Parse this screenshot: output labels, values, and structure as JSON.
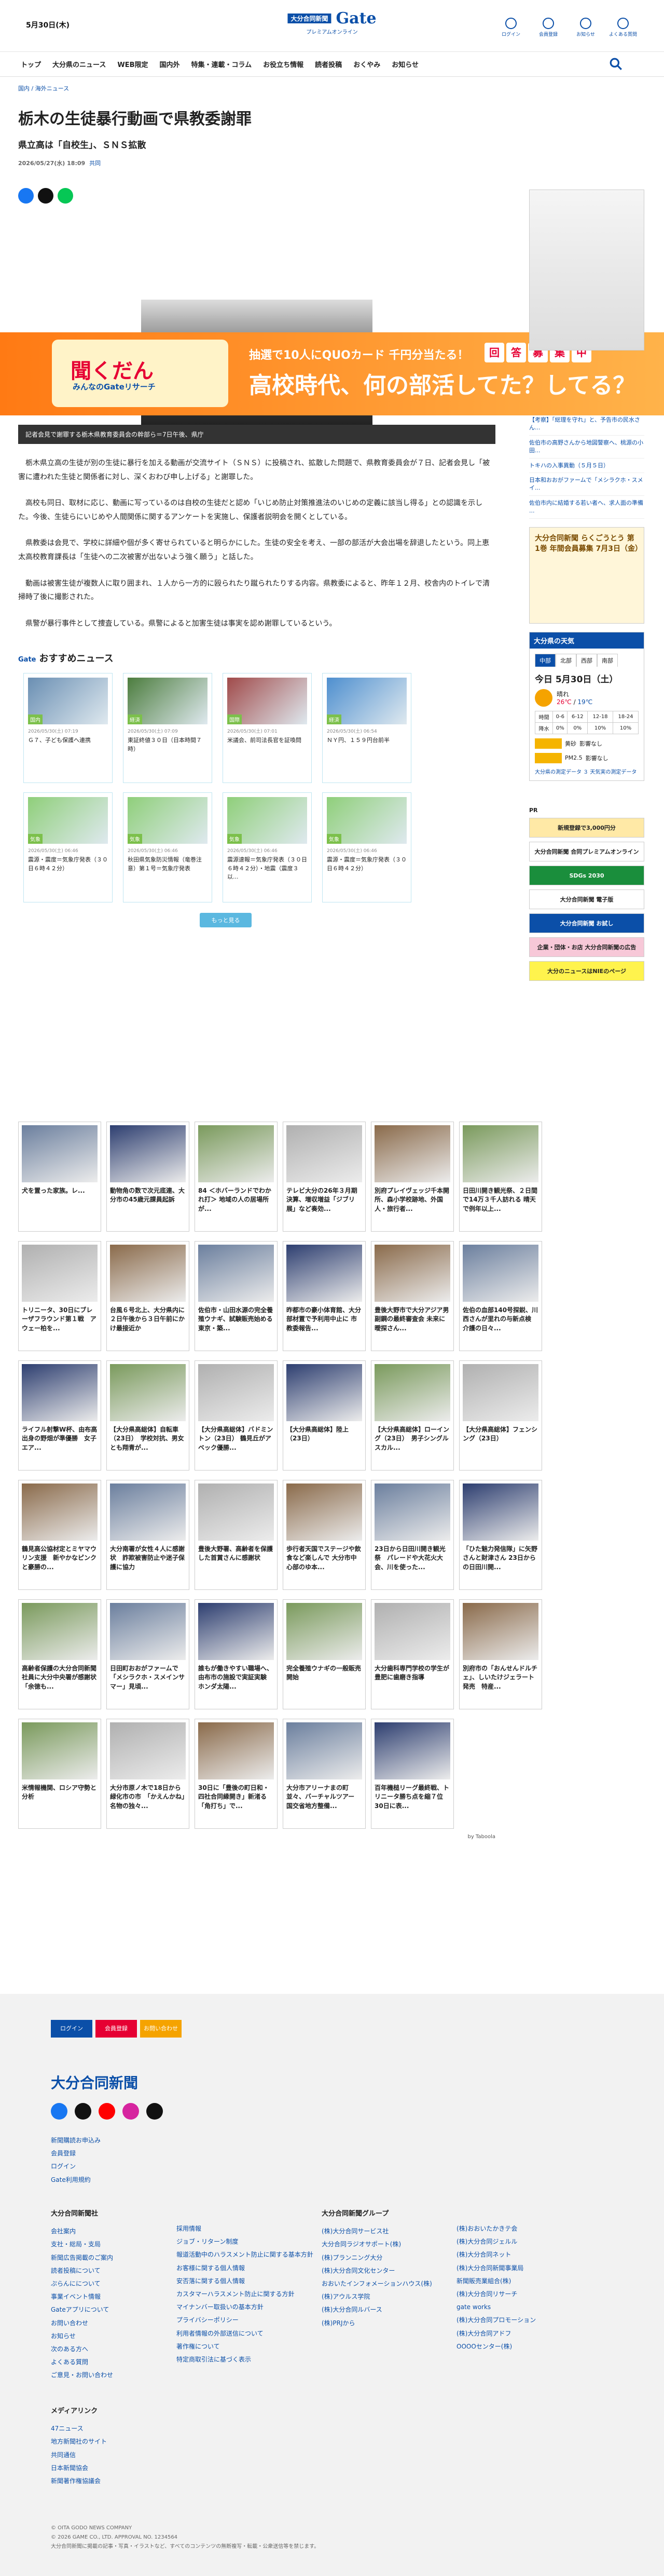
{
  "header": {
    "date": "5月30日(木)",
    "logo_top": "大分合同新聞",
    "logo_sub": "プレミアムオンライン",
    "logo_main": "Gate",
    "logo_kana": "ゲート",
    "links": [
      "ログイン",
      "会員登録",
      "お知らせ",
      "よくある質問"
    ]
  },
  "nav": [
    "トップ",
    "大分県のニュース",
    "WEB限定",
    "国内外",
    "特集・連載・コラム",
    "お役立ち情報",
    "読者投稿",
    "おくやみ",
    "お知らせ"
  ],
  "breadcrumb": "国内 / 海外ニュース",
  "article": {
    "title": "栃木の生徒暴行動画で県教委謝罪",
    "subtitle": "県立高は「自校生」、ＳＮＳ拡散",
    "date": "2026/05/27(水) 18:09",
    "source": "共同",
    "caption": "記者会見で謝罪する栃木県教育委員会の幹部ら＝7日午後、県庁",
    "paragraphs": [
      "栃木県立高の生徒が別の生徒に暴行を加える動画が交流サイト（ＳＮＳ）に投稿され、拡散した問題で、県教育委員会が７日、記者会見し「被害に遭われた生徒と関係者に対し、深くおわび申し上げる」と謝罪した。",
      "高校も同日、取材に応じ、動画に写っているのは自校の生徒だと認め「いじめ防止対策推進法のいじめの定義に該当し得る」との認識を示した。今後、生徒らにいじめや人間関係に関するアンケートを実施し、保護者説明会を開くとしている。",
      "県教委は会見で、学校に詳細や個が多く寄せられていると明らかにした。生徒の安全を考え、一部の部活が大会出場を辞退したという。同上恵太高校教育課長は「生徒への二次被害が出ないよう強く願う」と話した。",
      "動画は被害生徒が複数人に取り囲まれ、１人から一方的に殴られたり蹴られたりする内容。県教委によると、昨年１２月、校舎内のトイレで清掃時了後に撮影された。",
      "県警が暴行事件として捜査している。県警によると加害生徒は事実を認め謝罪しているという。"
    ]
  },
  "banner": {
    "line1": "抽選で10人にQUOカード 千円分当たる！",
    "line2": "高校時代、何の部活してた？してる？",
    "box1": "聞くだん",
    "box2": "みんなのGateリサーチ",
    "chips": [
      "回",
      "答",
      "募",
      "集",
      "中"
    ]
  },
  "osusume": {
    "title": "おすすめニュース",
    "brand": "Gate",
    "more": "もっと見る",
    "items": [
      {
        "tag": "国内",
        "date": "2026/05/30(土) 07:19",
        "title": "Ｇ７、子ども保護へ連携"
      },
      {
        "tag": "経済",
        "date": "2026/05/30(土) 07:09",
        "title": "東証終値３０日（日本時間７時）"
      },
      {
        "tag": "国際",
        "date": "2026/05/30(土) 07:01",
        "title": "米議会、前司法長官を証喚問"
      },
      {
        "tag": "経済",
        "date": "2026/05/30(土) 06:54",
        "title": "ＮＹ円、１５９円台前半"
      },
      {
        "tag": "気象",
        "date": "2026/05/30(土) 06:46",
        "title": "震源・震度＝気象庁発表（３０日６時４２分）"
      },
      {
        "tag": "気象",
        "date": "2026/05/30(土) 06:46",
        "title": "秋田県気象防災情報（竜巻注意）第１号＝気象庁発表"
      },
      {
        "tag": "気象",
        "date": "2026/05/30(土) 06:46",
        "title": "震源速報＝気象庁発表（３０日６時４２分）・地震（震度３以..."
      },
      {
        "tag": "気象",
        "date": "2026/05/30(土) 06:46",
        "title": "震源・震度＝気象庁発表（３０日６時４２分）"
      }
    ]
  },
  "taboola": {
    "by": "by Taboola",
    "items": [
      "犬を置った家族。レ...",
      "動物角の数で次元底連、大分市の45歳元課員起訴",
      "84 ＜ホバーランドでわかれ打＞ 地域の人の居場所が...",
      "テレビ大分の26年３月期決算、増収増益「ジブリ展」など奏効...",
      "別府プレイヴェッジ千本開所、森小学校跡地、外国人・旅行者...",
      "",
      "日田川開き観光祭、２日間で14万３千人訪れる 晴天で例年以上...",
      "トリニータ、30日にブレーザフラウンド第１戦　アウェー柏を...",
      "台風６号北上、大分県内に２日午後から３日午前にかけ最接近か",
      "佐伯市・山田水源の完全養殖ウナギ、試験販売始める 東京・築...",
      "昨都市の豪小体育館、大分部材置で予利用中止に 市教委報告...",
      "",
      "豊後大野市で大分アジア男副鋼の最終審査会 未来に曖探さん...",
      "佐伯の血部140号探鋭、川西さんが里れの与新点検　介護の日々...",
      "ライフル射撃W杯、由布高出身の野畑が準優勝　女子エア...",
      "【大分県高総体】自転車（23日）　学校対抗、男女とも翔青が...",
      "【大分県高総体】バドミントン（23日） 鶴見丘がアベック優勝...",
      "",
      "【大分県高総体】陸上（23日）",
      "【大分県高総体】ローイング（23日）　男子シングルスカル...",
      "【大分県高総体】フェンシング（23日）",
      "鶴見高公協材定とミヤマウリン支援　新やかなピンクと豪勝の...",
      "大分南署が女性４人に感謝状　詐欺被害防止や迷子保護に協力",
      "",
      "豊後大野署、高齢者を保護した首賞さんに感謝状",
      "歩行者天国でステージや飲食など楽しんで 大分市中心部のゆ本...",
      "23日から日田川開き観光祭　パレードや大花火大会、川を使った...",
      "「ひた魅力発信隊」に矢野さんと財津さん 23日からの日田川開...",
      "高齢者保護の大分合同新聞社員に大分中央署が感謝状　「余徳も...",
      "",
      "日田町おおがファームで「メシラクホ・スメインサマー」見頃...",
      "誰もが働きやすい職場へ、由布市の施設で実証実験 ホンダ太陽...",
      "完全養殖ウナギの一般販売開始",
      "大分歯科専門学校の学生が豊肥に歯磨き指導",
      "別府市の「おんせんドルチェ」、しいたけジェラート発売　特産...",
      "",
      "米情報機関、ロシア守勢と分析",
      "大分市原ノ木で18日から緑化市の市　「かえんかね」名物の独々...",
      "30日に「豊後の町日和・四社合同縁開き」新渚る「角打ち」で...",
      "大分市アリーナまの町並々、バーチャルツアー 国交省地方整備...",
      "百年機槌リーグ最終戦、トリニータ勝ち点を縮７位　30日に表...",
      ""
    ]
  },
  "sidebar": {
    "ranking": [
      "【考察】「総理を守れ」と、予告市の民水さん...",
      "佐伯市の高野さんから地図警察へ、桃源の小田...",
      "トキハの入事異動（５月５日）",
      "日本和おおがファームで「メシラクホ・スメイ...",
      "佐伯市内に結婚する若い者へ、求人面の準備 ..."
    ],
    "ad1": "大分合同新聞 らくごうとう 第1巻 年間会員募集 7月3日（金）",
    "weather": {
      "title": "大分県の天気",
      "tabs": [
        "中部",
        "北部",
        "西部",
        "南部"
      ],
      "day": "今日 5月30日（土）",
      "cond": "晴れ",
      "hi": "26℃",
      "lo": "19℃",
      "cols": [
        "時間",
        "0-6",
        "6-12",
        "12-18",
        "18-24"
      ],
      "rain": [
        "降水",
        "0%",
        "0%",
        "10%",
        "10%"
      ],
      "pollen1": "黄砂",
      "pollen1v": "影響なし",
      "pollen2": "PM2.5",
      "pollen2v": "影響なし",
      "more": "大分県の測定データ ３ 天気実の測定データ"
    },
    "pr": "PR",
    "btns": [
      "新規登録で3,000円分",
      "大分合同新聞 合同プレミアムオンライン",
      "SDGs 2030",
      "大分合同新聞 電子版",
      "大分合同新聞 お試し",
      "企業・団体・お店 大分合同新聞の広告",
      "大分のニュースはNIEのページ"
    ]
  },
  "footer": {
    "buttons": [
      "ログイン",
      "会員登録",
      "お問い合わせ"
    ],
    "logo": "大分合同新聞",
    "links1": [
      "新聞購読お申込み",
      "会員登録",
      "ログイン",
      "Gate利用規約"
    ],
    "grp1": "大分合同新聞社",
    "col1": [
      "会社案内",
      "支社・総局・支局",
      "新聞広告掲載のご案内",
      "読者投稿について",
      "ぷらんにについて",
      "事業イベント情報",
      "Gateアプリについて",
      "お問い合わせ",
      "お知らせ",
      "次のある方へ",
      "よくある質問",
      "ご意見・お問い合わせ"
    ],
    "col2": [
      "採用情報",
      "ジョブ・リターン制度",
      "報道活動中のハラスメント防止に関する基本方針",
      "お客様に関する個人情報",
      "安否落に関する個人情報",
      "カスタマーハラスメント防止に関する方針",
      "マイナンバー取扱いの基本方針",
      "プライバシーポリシー",
      "利用者情報の外部送信について",
      "著作権について",
      "特定商取引法に基づく表示"
    ],
    "grp2": "大分合同新聞グループ",
    "col3": [
      "(株)大分合同サービス社",
      "大分合同ラジオサポート(株)",
      "(株)プランニング大分",
      "(株)大分合同文化センター",
      "おおいたインフォメーションハウス(株)",
      "(株)アウルス学院",
      "(株)大分合同ルバース",
      "(株)PRJから"
    ],
    "col4": [
      "(株)おおいたかきテ会",
      "(株)大分合同ジェルル",
      "(株)大分合同ネット",
      "(株)大分合同新聞事業局",
      "新聞販売業組合(株)",
      "(株)大分合同リサーチ",
      "gate works",
      "(株)大分合同プロモーション",
      "(株)大分合同アドフ",
      "OOOOセンター(株)"
    ],
    "grp3": "メディアリンク",
    "col5": [
      "47ニュース",
      "地方新聞社のサイト",
      "共同通信",
      "日本新聞協会",
      "新聞著作権協議会"
    ],
    "copy1": "© OITA GODO NEWS COMPANY",
    "copy2": "© 2026 GAME CO., LTD. APPROVAL NO. 1234564",
    "copy3": "大分合同新聞に掲載の記事・写真・イラストなど、すべてのコンテンツの無断複写・転載・公衆送信等を禁じます。"
  }
}
